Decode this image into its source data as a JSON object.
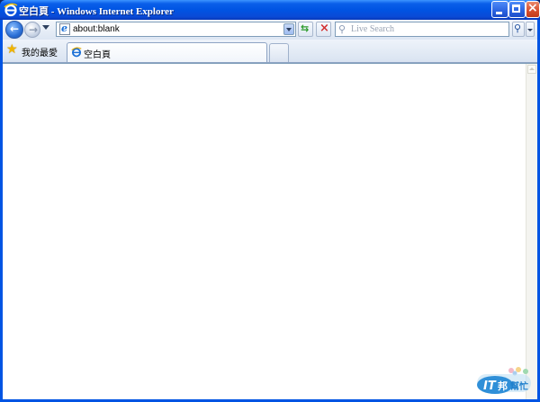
{
  "window": {
    "title": "空白頁 - Windows Internet Explorer",
    "buttons": {
      "minimize": "Minimize",
      "maximize": "Maximize",
      "close": "Close"
    }
  },
  "navigation": {
    "back_icon": "back-arrow-icon",
    "forward_icon": "forward-arrow-icon",
    "address": {
      "value": "about:blank",
      "page_icon": "ie-page-icon"
    },
    "refresh_icon": "refresh-icon",
    "stop_icon": "stop-icon",
    "search": {
      "placeholder": "Live Search",
      "go_icon": "search-icon"
    }
  },
  "tabs": {
    "favorites_label": "我的最愛",
    "items": [
      {
        "label": "空白頁",
        "active": true
      }
    ]
  },
  "watermark": {
    "brand": "IT邦幫忙"
  },
  "colors": {
    "titlebar": "#0054e3",
    "chrome": "#e8edf5",
    "content": "#ffffff"
  }
}
